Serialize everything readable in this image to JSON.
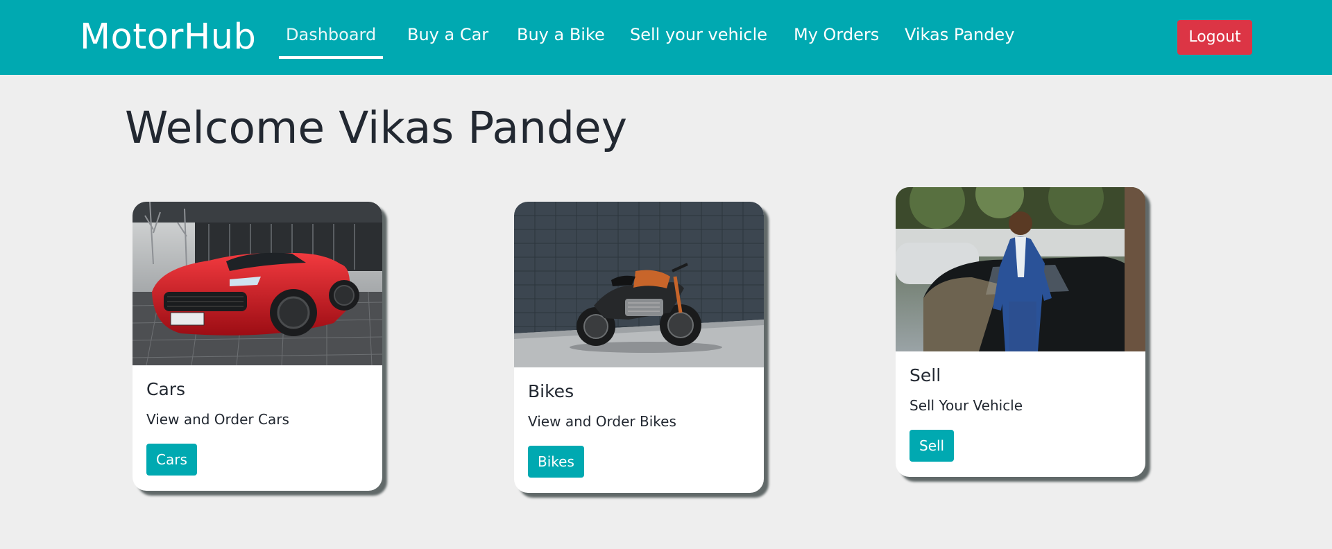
{
  "nav": {
    "brand": "MotorHub",
    "links": [
      {
        "label": "Dashboard",
        "active": true
      },
      {
        "label": "Buy a Car"
      },
      {
        "label": "Buy a Bike"
      },
      {
        "label": "Sell your vehicle"
      },
      {
        "label": "My Orders"
      },
      {
        "label": "Vikas Pandey"
      }
    ],
    "logout_label": "Logout"
  },
  "page": {
    "welcome": "Welcome Vikas Pandey"
  },
  "cards": [
    {
      "image": "red-sports-car-photo",
      "title": "Cars",
      "text": "View and Order Cars",
      "button": "Cars"
    },
    {
      "image": "black-motorcycle-photo",
      "title": "Bikes",
      "text": "View and Order Bikes",
      "button": "Bikes"
    },
    {
      "image": "man-with-car-photo",
      "title": "Sell",
      "text": "Sell Your Vehicle",
      "button": "Sell"
    }
  ],
  "colors": {
    "primary": "#00a9b1",
    "danger": "#dc3545",
    "background": "#eeeeee",
    "text": "#222831"
  }
}
